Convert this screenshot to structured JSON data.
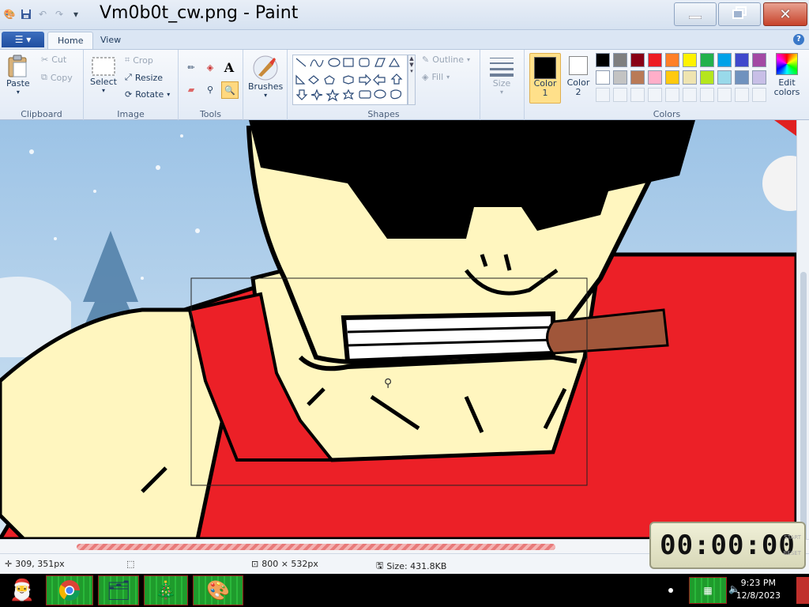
{
  "window": {
    "title": "Vm0b0t_cw.png - Paint",
    "minimize_icon": "minimize-icon",
    "maximize_icon": "restore-icon",
    "close_icon": "close-icon"
  },
  "quick_access": [
    "paint-app-icon",
    "save-icon",
    "undo-icon",
    "redo-icon",
    "customize-dropdown-icon"
  ],
  "tabs": [
    {
      "label": "Home",
      "active": true
    },
    {
      "label": "View",
      "active": false
    }
  ],
  "ribbon": {
    "clipboard": {
      "group": "Clipboard",
      "paste": "Paste",
      "cut": "Cut",
      "copy": "Copy"
    },
    "image": {
      "group": "Image",
      "select": "Select",
      "crop": "Crop",
      "resize": "Resize",
      "rotate": "Rotate"
    },
    "tools": {
      "group": "Tools",
      "text_tool": "A"
    },
    "brushes": {
      "label": "Brushes"
    },
    "shapes": {
      "group": "Shapes",
      "outline": "Outline",
      "fill": "Fill"
    },
    "size": {
      "label": "Size"
    },
    "colors": {
      "group": "Colors",
      "color1": "Color 1",
      "color2": "Color 2",
      "edit_colors": "Edit colors",
      "color1_value": "#000000",
      "color2_value": "#ffffff",
      "palette_row1": [
        "#000000",
        "#7f7f7f",
        "#880015",
        "#ed1c24",
        "#ff7f27",
        "#fff200",
        "#22b14c",
        "#00a2e8",
        "#3f48cc",
        "#a349a4"
      ],
      "palette_row2": [
        "#ffffff",
        "#c3c3c3",
        "#b97a57",
        "#ffaec9",
        "#ffc90e",
        "#efe4b0",
        "#b5e61d",
        "#99d9ea",
        "#7092be",
        "#c8bfe7"
      ],
      "palette_row3": [
        "#f0f4f9",
        "#f0f4f9",
        "#f0f4f9",
        "#f0f4f9",
        "#f0f4f9",
        "#f0f4f9",
        "#f0f4f9",
        "#f0f4f9",
        "#f0f4f9",
        "#f0f4f9"
      ]
    }
  },
  "status": {
    "cursor_pos": "309, 351px",
    "image_size": "800 × 532px",
    "file_size": "Size: 431.8KB"
  },
  "timer": {
    "display": "00:00:00",
    "start": "START",
    "reset": "RESET"
  },
  "taskbar": {
    "time": "9:23 PM",
    "date": "12/8/2023"
  }
}
